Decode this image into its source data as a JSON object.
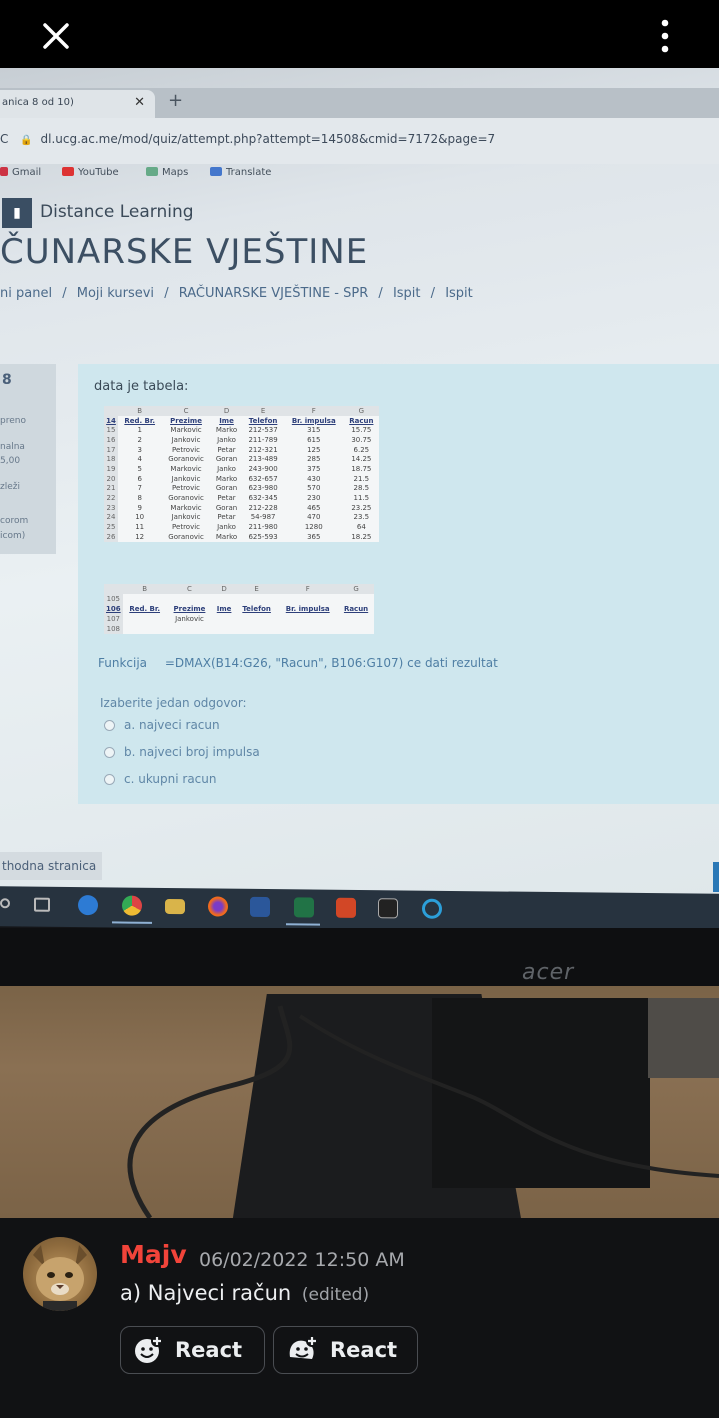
{
  "topbar": {
    "close_icon": "close-icon",
    "more_icon": "more-vertical-icon"
  },
  "browser": {
    "tab_title": "anica 8 od 10)",
    "url": "dl.ucg.ac.me/mod/quiz/attempt.php?attempt=14508&cmid=7172&page=7",
    "bookmarks": [
      "Gmail",
      "YouTube",
      "Maps",
      "Translate"
    ]
  },
  "site": {
    "name": "Distance Learning",
    "course_title": "ČUNARSKE VJEŠTINE",
    "breadcrumb": [
      "ni panel",
      "/",
      "Moji kursevi",
      "/",
      "RAČUNARSKE VJEŠTINE - SPR",
      "/",
      "Ispit",
      "/",
      "Ispit"
    ]
  },
  "left_panel": {
    "number": "8",
    "lines": [
      "preno",
      "nalna",
      "5,00",
      "zleži",
      "corom",
      "icom)"
    ]
  },
  "question": {
    "intro": "data je tabela:",
    "table": {
      "col_letters": [
        "B",
        "C",
        "D",
        "E",
        "F",
        "G"
      ],
      "header_row": "14",
      "headers": [
        "Red. Br.",
        "Prezime",
        "Ime",
        "Telefon",
        "Br. impulsa",
        "Racun"
      ],
      "rows": [
        [
          "15",
          "1",
          "Markovic",
          "Marko",
          "212-537",
          "315",
          "15.75"
        ],
        [
          "16",
          "2",
          "Jankovic",
          "Janko",
          "211-789",
          "615",
          "30.75"
        ],
        [
          "17",
          "3",
          "Petrovic",
          "Petar",
          "212-321",
          "125",
          "6.25"
        ],
        [
          "18",
          "4",
          "Goranovic",
          "Goran",
          "213-489",
          "285",
          "14.25"
        ],
        [
          "19",
          "5",
          "Markovic",
          "Janko",
          "243-900",
          "375",
          "18.75"
        ],
        [
          "20",
          "6",
          "Jankovic",
          "Marko",
          "632-657",
          "430",
          "21.5"
        ],
        [
          "21",
          "7",
          "Petrovic",
          "Goran",
          "623-980",
          "570",
          "28.5"
        ],
        [
          "22",
          "8",
          "Goranovic",
          "Petar",
          "632-345",
          "230",
          "11.5"
        ],
        [
          "23",
          "9",
          "Markovic",
          "Goran",
          "212-228",
          "465",
          "23.25"
        ],
        [
          "24",
          "10",
          "Jankovic",
          "Petar",
          "54-987",
          "470",
          "23.5"
        ],
        [
          "25",
          "11",
          "Petrovic",
          "Janko",
          "211-980",
          "1280",
          "64"
        ],
        [
          "26",
          "12",
          "Goranovic",
          "Marko",
          "625-593",
          "365",
          "18.25"
        ]
      ]
    },
    "criteria_table": {
      "col_letters": [
        "B",
        "C",
        "D",
        "E",
        "F",
        "G"
      ],
      "rows_nums": [
        "105",
        "106",
        "107",
        "108"
      ],
      "headers": [
        "Red. Br.",
        "Prezime",
        "Ime",
        "Telefon",
        "Br. impulsa",
        "Racun"
      ],
      "value": "Jankovic"
    },
    "function_label": "Funkcija",
    "function_text": "=DMAX(B14:G26, \"Racun\", B106:G107) ce dati rezultat",
    "choose_label": "Izaberite jedan odgovor:",
    "options": [
      "a. najveci racun",
      "b. najveci broj impulsa",
      "c. ukupni racun"
    ]
  },
  "nav": {
    "prev_page": "thodna stranica"
  },
  "monitor_brand": "acer",
  "message": {
    "author": "Majv",
    "timestamp": "06/02/2022 12:50 AM",
    "text": "a) Najveci račun",
    "edited": "(edited)",
    "react_label_1": "React",
    "react_label_2": "React"
  },
  "colors": {
    "author": "#f2443a",
    "background": "#111214",
    "accent": "#2a78b6"
  }
}
